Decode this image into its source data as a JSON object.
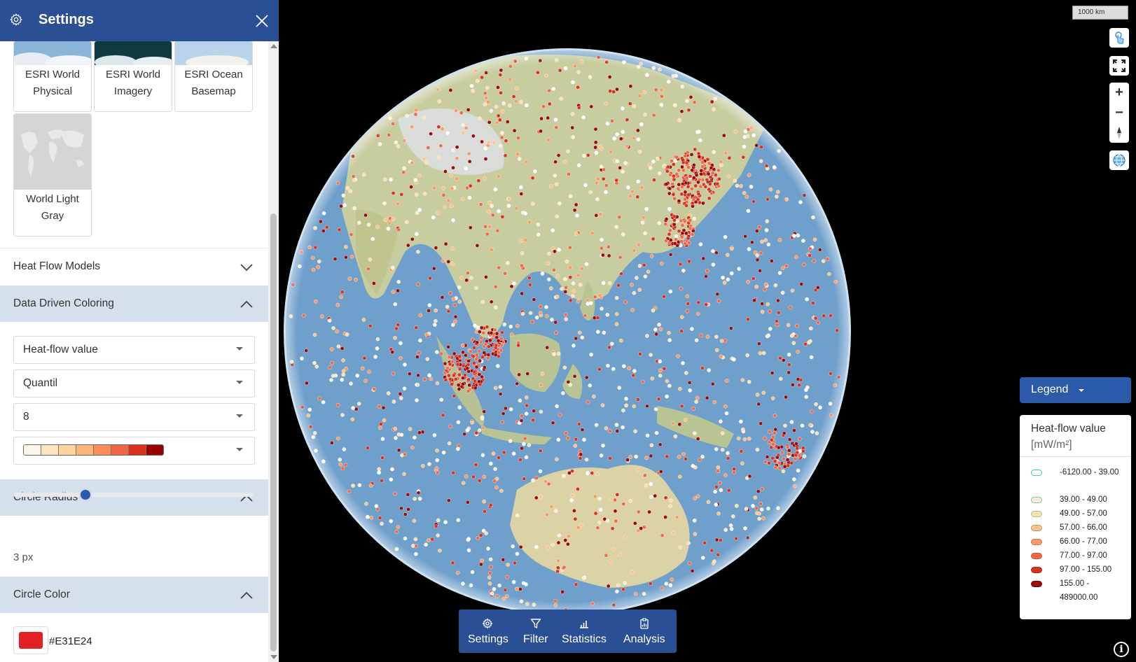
{
  "header": {
    "title": "Settings"
  },
  "basemaps": [
    {
      "label": "ESRI World Physical",
      "thumb": "physical"
    },
    {
      "label": "ESRI World Imagery",
      "thumb": "imagery"
    },
    {
      "label": "ESRI Ocean Basemap",
      "thumb": "ocean"
    },
    {
      "label": "World Light Gray",
      "thumb": "gray"
    }
  ],
  "sections": {
    "heat_flow_models": "Heat Flow Models",
    "data_driven_coloring": "Data Driven Coloring",
    "circle_radius": "Circle Radius",
    "circle_color": "Circle Color"
  },
  "coloring": {
    "attribute": "Heat-flow value",
    "method": "Quantil",
    "classes": "8",
    "ramp": [
      "#fdf5e6",
      "#fde3be",
      "#fdd49e",
      "#fcb47b",
      "#fc8d59",
      "#ef6548",
      "#d7301f",
      "#990000"
    ]
  },
  "radius": {
    "value": 3,
    "label": "3 px",
    "min": 0,
    "max": 10
  },
  "color": {
    "hex": "#E31E24",
    "label": "#E31E24"
  },
  "map": {
    "scale_label": "1000 km"
  },
  "toolbar": [
    {
      "label": "Settings",
      "icon": "gear-icon"
    },
    {
      "label": "Filter",
      "icon": "filter-icon"
    },
    {
      "label": "Statistics",
      "icon": "bar-chart-icon"
    },
    {
      "label": "Analysis",
      "icon": "clipboard-chart-icon"
    }
  ],
  "legend": {
    "button_label": "Legend",
    "title": "Heat-flow value",
    "unit": "[mW/m²]",
    "items": [
      {
        "label": "-6120.00 - 39.00",
        "fill": "#ffffff",
        "stroke": "#3ac6a8"
      },
      {
        "label": "39.00 - 49.00",
        "fill": "#fcefd8",
        "stroke": "#7cc3a0"
      },
      {
        "label": "49.00 - 57.00",
        "fill": "#fce0b0",
        "stroke": "#9cc59a"
      },
      {
        "label": "57.00 - 66.00",
        "fill": "#fcc386",
        "stroke": "#b0a060"
      },
      {
        "label": "66.00 - 77.00",
        "fill": "#fb9a62",
        "stroke": "#c77a50"
      },
      {
        "label": "77.00 - 97.00",
        "fill": "#f06a47",
        "stroke": "#c75a40"
      },
      {
        "label": "97.00 - 155.00",
        "fill": "#d83321",
        "stroke": "#a82a1c"
      },
      {
        "label": "155.00 - 489000.00",
        "fill": "#9b0d0d",
        "stroke": "#5a0a0a"
      }
    ]
  }
}
